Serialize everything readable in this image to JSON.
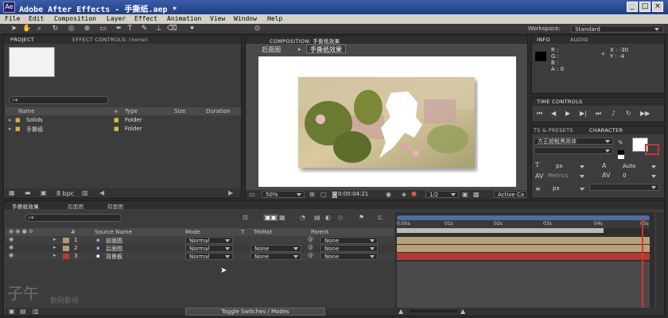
{
  "window": {
    "title": "Adobe After Effects - 手撕纸.aep *",
    "minimize": "_",
    "maximize": "□",
    "close": "×"
  },
  "menu": [
    "File",
    "Edit",
    "Composition",
    "Layer",
    "Effect",
    "Animation",
    "View",
    "Window",
    "Help"
  ],
  "workspace": {
    "label": "Workspace:",
    "value": "Standard"
  },
  "project_panel": {
    "tabs": [
      "PROJECT",
      "EFFECT CONTROLS: (none)"
    ],
    "search_placeholder": "",
    "columns": [
      "Name",
      "Type",
      "Size",
      "Duration"
    ],
    "items": [
      {
        "name": "Solids",
        "type": "Folder"
      },
      {
        "name": "手撕纸",
        "type": "Folder"
      }
    ],
    "bpc": "8 bpc"
  },
  "composition_panel": {
    "tab": "COMPOSITION: 手撕纸效果",
    "breadcrumbs": [
      "后面图",
      "手撕纸效果"
    ],
    "zoom": "50%",
    "timecode": "0:00:04:21",
    "resolution": "1/2",
    "camera": "Active Ca"
  },
  "info_panel": {
    "tabs": [
      "INFO",
      "AUDIO"
    ],
    "r": "R :",
    "g": "G :",
    "b": "B :",
    "a": "A : 0",
    "x": "X : -30",
    "y": "Y : -4"
  },
  "time_controls": {
    "tab": "TIME CONTROLS"
  },
  "character_panel": {
    "tabs": [
      "TS & PRESETS",
      "CHARACTER"
    ],
    "font": "方正超粗黑简体",
    "size_unit": "px",
    "leading": "Auto",
    "metrics": "Metrics",
    "tracking": "0",
    "stroke_unit": "px"
  },
  "timeline": {
    "tabs": [
      "手撕纸效果",
      "后面图",
      "前面图"
    ],
    "search_placeholder": "",
    "columns": {
      "source_name": "Source Name",
      "mode": "Mode",
      "t": "T",
      "trkmat": "TrkMat",
      "parent": "Parent",
      "num": "#"
    },
    "ruler": [
      "0:00s",
      "01s",
      "02s",
      "03s",
      "04s",
      "05s"
    ],
    "layers": [
      {
        "num": "1",
        "name": "前面图",
        "mode": "Normal",
        "trkmat": "",
        "parent": "None",
        "label_color": "#b09a72",
        "bar_color": "#b8a07a"
      },
      {
        "num": "2",
        "name": "后面图",
        "mode": "Normal",
        "trkmat": "None",
        "parent": "None",
        "label_color": "#b09a72",
        "bar_color": "#b8a07a"
      },
      {
        "num": "3",
        "name": "背景板",
        "mode": "Normal",
        "trkmat": "None",
        "parent": "None",
        "label_color": "#c0383b",
        "bar_color": "#b23a35"
      }
    ],
    "toggle": "Toggle Switches / Modes"
  },
  "watermark": {
    "brand": "子午",
    "sub": "数码影视"
  },
  "colors": {
    "accent": "#1f3f86",
    "panel": "#3c3c3c",
    "playhead": "#e0302a"
  }
}
